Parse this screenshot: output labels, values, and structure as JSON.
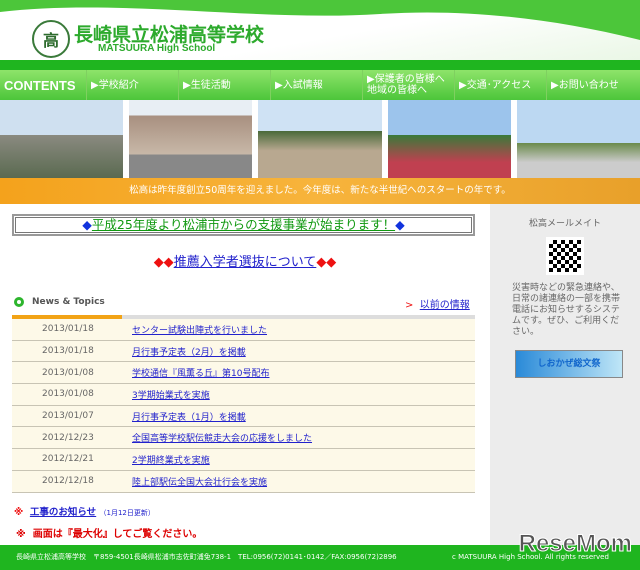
{
  "header": {
    "logo_char": "高",
    "title": "長崎県立松浦高等学校",
    "subtitle": "MATSUURA High School"
  },
  "nav": [
    {
      "label": "CONTENTS"
    },
    {
      "label": "▶学校紹介"
    },
    {
      "label": "▶生徒活動"
    },
    {
      "label": "▶入試情報"
    },
    {
      "label": "▶保護者の皆様へ地域の皆様へ"
    },
    {
      "label": "▶交通･アクセス"
    },
    {
      "label": "▶お問い合わせ"
    }
  ],
  "banner": "松高は昨年度創立50周年を迎えました。今年度は、新たな半世紀へのスタートの年です。",
  "main": {
    "notice_diamond": "◆",
    "notice": "平成25年度より松浦市からの支援事業が始まります！",
    "selection_diamonds": "◆◆",
    "selection": "推薦入学者選抜について",
    "news_title": "News & Topics",
    "older_arrow": ">",
    "older": "以前の情報",
    "news": [
      {
        "date": "2013/01/18",
        "title": "センター試験出陣式を行いました"
      },
      {
        "date": "2013/01/18",
        "title": "月行事予定表（2月）を掲載"
      },
      {
        "date": "2013/01/08",
        "title": "学校通信『風薫る丘』第10号配布"
      },
      {
        "date": "2013/01/08",
        "title": "3学期始業式を実施"
      },
      {
        "date": "2013/01/07",
        "title": "月行事予定表（1月）を掲載"
      },
      {
        "date": "2012/12/23",
        "title": "全国高等学校駅伝競走大会の応援をしました"
      },
      {
        "date": "2012/12/21",
        "title": "2学期終業式を実施"
      },
      {
        "date": "2012/12/18",
        "title": "陸上部駅伝全国大会壮行会を実施"
      }
    ],
    "mark": "※",
    "construction": "工事のお知らせ",
    "construction_date": "（1月12日更新）",
    "maximize": "画面は『最大化』してご覧ください。"
  },
  "side": {
    "mail_title": "松高メールメイト",
    "mail_desc": "災害時などの緊急連絡や、日常の諸連絡の一部を携帯電話にお知らせするシステムです。ぜひ、ご利用ください。",
    "banner": "しおかぜ総文祭"
  },
  "footer": {
    "address": "長崎県立松浦高等学校　〒859-4501長崎県松浦市志佐町浦免738-1　TEL:0956(72)0141･0142／FAX:0956(72)2896",
    "copyright": "c MATSUURA High School. All rights reserved"
  },
  "watermark": "ReseMom"
}
